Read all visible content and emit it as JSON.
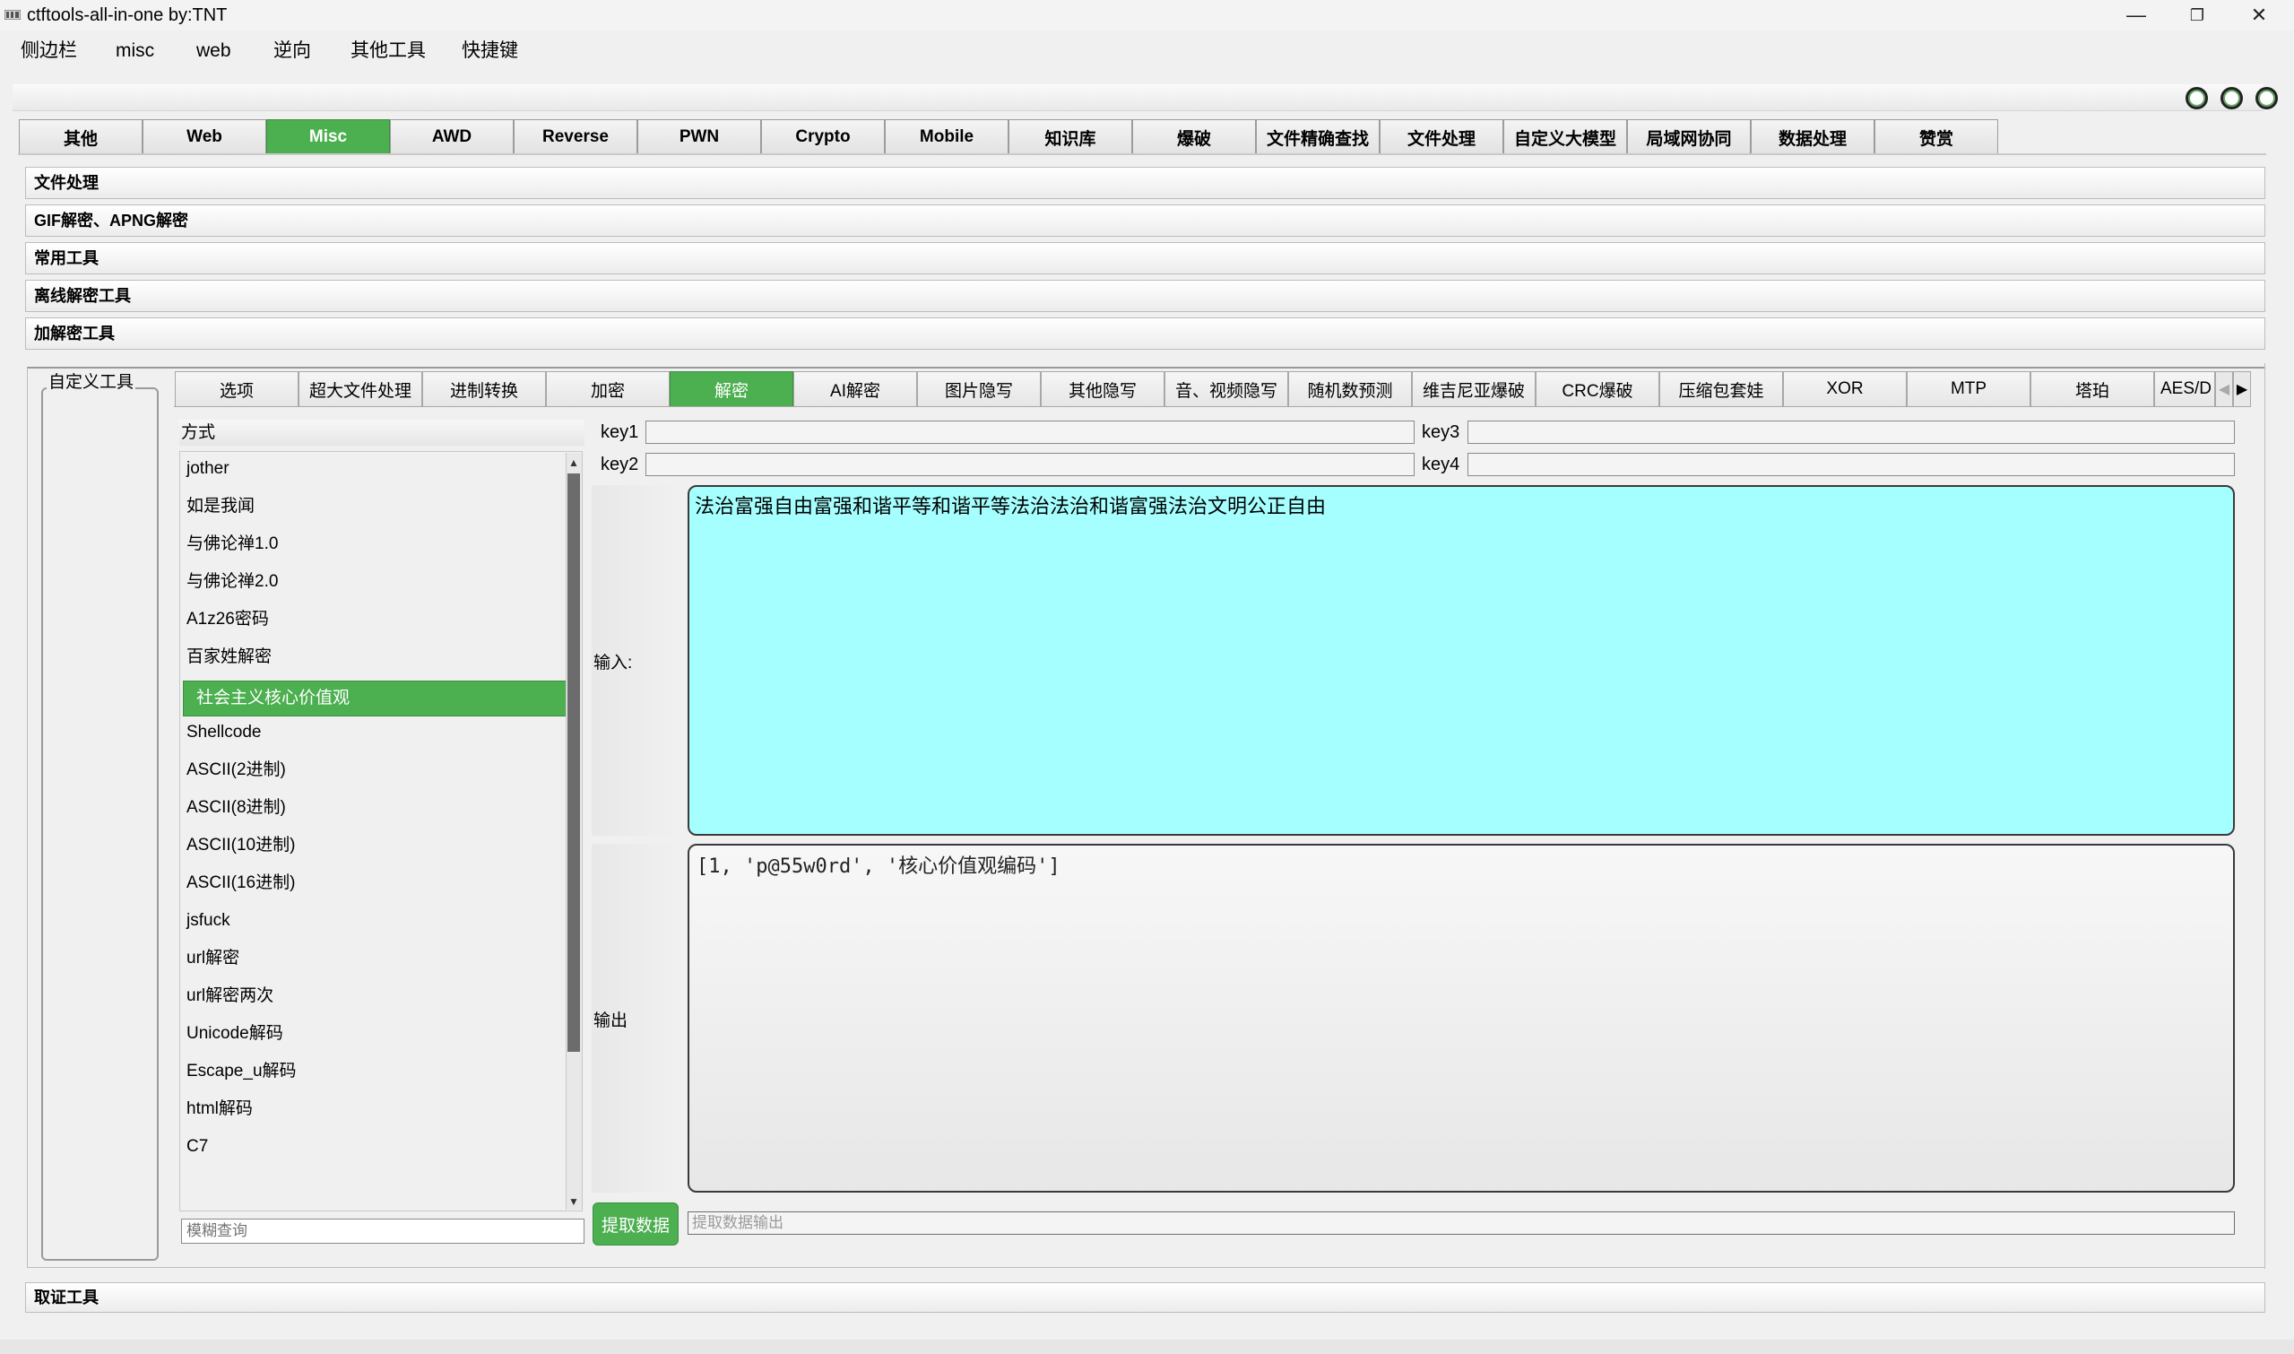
{
  "window": {
    "title": "ctftools-all-in-one   by:TNT",
    "minimize_glyph": "—",
    "restore_glyph": "❐",
    "close_glyph": "✕"
  },
  "menubar": {
    "items": [
      "侧边栏",
      "misc",
      "web",
      "逆向",
      "其他工具",
      "快捷键"
    ]
  },
  "toolbar": {
    "round_buttons": [
      "circle-icon",
      "circle-icon",
      "circle-icon"
    ]
  },
  "main_tabs": {
    "items": [
      "其他",
      "Web",
      "Misc",
      "AWD",
      "Reverse",
      "PWN",
      "Crypto",
      "Mobile",
      "知识库",
      "爆破",
      "文件精确查找",
      "文件处理",
      "自定义大模型",
      "局域网协同",
      "数据处理",
      "赞赏"
    ],
    "active": "Misc"
  },
  "sections": {
    "file_processing": "文件处理",
    "gif_decrypt": "GIF解密、APNG解密",
    "common_tools": "常用工具",
    "offline_decrypt": "离线解密工具",
    "encrypt_decrypt": "加解密工具",
    "custom_tools": "自定义工具",
    "forensics": "取证工具"
  },
  "sub_tabs": {
    "items": [
      "选项",
      "超大文件处理",
      "进制转换",
      "加密",
      "解密",
      "AI解密",
      "图片隐写",
      "其他隐写",
      "音、视频隐写",
      "随机数预测",
      "维吉尼亚爆破",
      "CRC爆破",
      "压缩包套娃",
      "XOR",
      "MTP",
      "塔珀",
      "AES/D"
    ],
    "active": "解密",
    "scroll_left": "◀",
    "scroll_right": "▶"
  },
  "method": {
    "header": "方式",
    "items": [
      "jother",
      "如是我闻",
      "与佛论禅1.0",
      "与佛论禅2.0",
      "A1z26密码",
      "百家姓解密",
      "社会主义核心价值观",
      "Shellcode",
      "ASCII(2进制)",
      "ASCII(8进制)",
      "ASCII(10进制)",
      "ASCII(16进制)",
      "jsfuck",
      "url解密",
      "url解密两次",
      "Unicode解码",
      "Escape_u解码",
      "html解码",
      "C7"
    ],
    "selected": "社会主义核心价值观",
    "search_placeholder": "模糊查询",
    "scroll_up": "▲",
    "scroll_down": "▼"
  },
  "keys": {
    "key1_label": "key1",
    "key2_label": "key2",
    "key3_label": "key3",
    "key4_label": "key4",
    "key1_value": "",
    "key2_value": "",
    "key3_value": "",
    "key4_value": ""
  },
  "io": {
    "input_label": "输入:",
    "input_value": "法治富强自由富强和谐平等和谐平等法治法治和谐富强法治文明公正自由",
    "output_label": "输出",
    "output_value": "[1, 'p@55w0rd', '核心价值观编码']",
    "extract_button": "提取数据",
    "extract_placeholder": "提取数据输出"
  },
  "colors": {
    "accent_green": "#4caf50",
    "input_bg": "#a6ffff"
  }
}
